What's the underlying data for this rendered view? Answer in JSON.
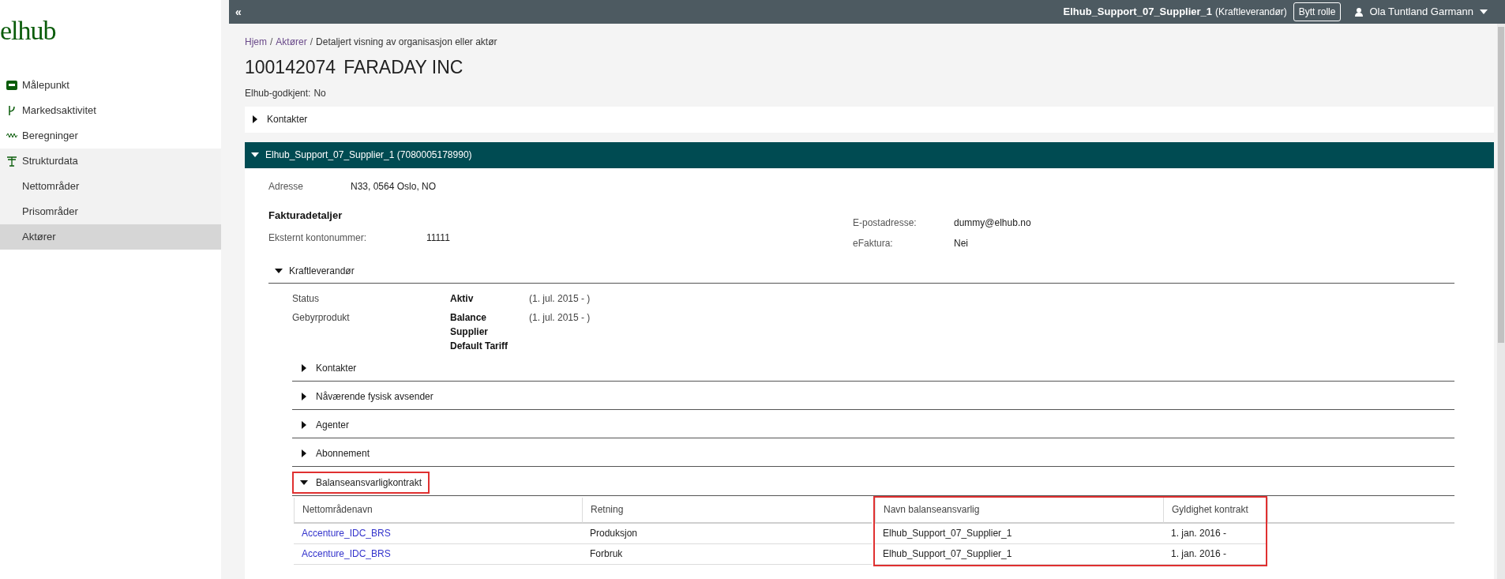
{
  "topbar": {
    "collapse": "«",
    "organisation": "Elhub_Support_07_Supplier_1",
    "role": "(Kraftleverandør)",
    "switch_button": "Bytt rolle",
    "user": "Ola Tuntland Garmann"
  },
  "sidebar": {
    "logo": "elhub",
    "items": [
      {
        "label": "Målepunkt",
        "kind": "meter",
        "selected": false
      },
      {
        "label": "Markedsaktivitet",
        "kind": "branch",
        "selected": false
      },
      {
        "label": "Beregninger",
        "kind": "wave",
        "selected": false
      },
      {
        "label": "Strukturdata",
        "kind": "pylon",
        "selected": false,
        "expanded": true,
        "children": [
          {
            "label": "Nettområder",
            "selected": false
          },
          {
            "label": "Prisområder",
            "selected": false
          },
          {
            "label": "Aktører",
            "selected": true
          }
        ]
      }
    ]
  },
  "breadcrumb": [
    {
      "label": "Hjem",
      "kind": "link"
    },
    {
      "label": "/",
      "kind": "separator"
    },
    {
      "label": "Aktører",
      "kind": "link"
    },
    {
      "label": "/",
      "kind": "separator"
    },
    {
      "label": "Detaljert visning av organisasjon eller aktør",
      "kind": "current"
    }
  ],
  "title": {
    "number": "100142074",
    "name": "FARADAY INC"
  },
  "approved": {
    "label": "Elhub-godkjent:",
    "value": "No"
  },
  "contacts": {
    "label": "Kontakter",
    "expanded": false
  },
  "actor": {
    "title": "Elhub_Support_07_Supplier_1 (7080005178990)",
    "expanded": true,
    "address": {
      "label": "Adresse",
      "value": "N33, 0564 Oslo, NO"
    },
    "invoice": {
      "heading": "Fakturadetaljer",
      "left": [
        {
          "label": "Eksternt kontonummer:",
          "value": "11111"
        }
      ],
      "right": [
        {
          "label": "E-postadresse:",
          "value": "dummy@elhub.no"
        },
        {
          "label": "eFaktura:",
          "value": "Nei"
        }
      ]
    },
    "role": {
      "label": "Kraftleverandør",
      "expanded": true,
      "details": [
        {
          "label": "Status",
          "value": "Aktiv",
          "period": "(1. jul. 2015 - )"
        },
        {
          "label": "Gebyrprodukt",
          "value": "Balance Supplier Default Tariff",
          "period": "(1. jul. 2015 - )"
        }
      ],
      "subsections": [
        {
          "label": "Kontakter",
          "expanded": false,
          "highlighted": false
        },
        {
          "label": "Nåværende fysisk avsender",
          "expanded": false,
          "highlighted": false
        },
        {
          "label": "Agenter",
          "expanded": false,
          "highlighted": false
        },
        {
          "label": "Abonnement",
          "expanded": false,
          "highlighted": false
        },
        {
          "label": "Balanseansvarligkontrakt",
          "expanded": true,
          "highlighted": true,
          "table": {
            "columns": [
              {
                "label": "Nettområdenavn",
                "kind": "link",
                "highlighted": false
              },
              {
                "label": "Retning",
                "kind": "text",
                "highlighted": false
              },
              {
                "label": "Navn balanseansvarlig",
                "kind": "text",
                "highlighted": true
              },
              {
                "label": "Gyldighet kontrakt",
                "kind": "text",
                "highlighted": true
              }
            ],
            "rows": [
              [
                "Accenture_IDC_BRS",
                "Produksjon",
                "Elhub_Support_07_Supplier_1",
                "1. jan. 2016 -"
              ],
              [
                "Accenture_IDC_BRS",
                "Forbruk",
                "Elhub_Support_07_Supplier_1",
                "1. jan. 2016 -"
              ]
            ]
          }
        }
      ]
    }
  }
}
